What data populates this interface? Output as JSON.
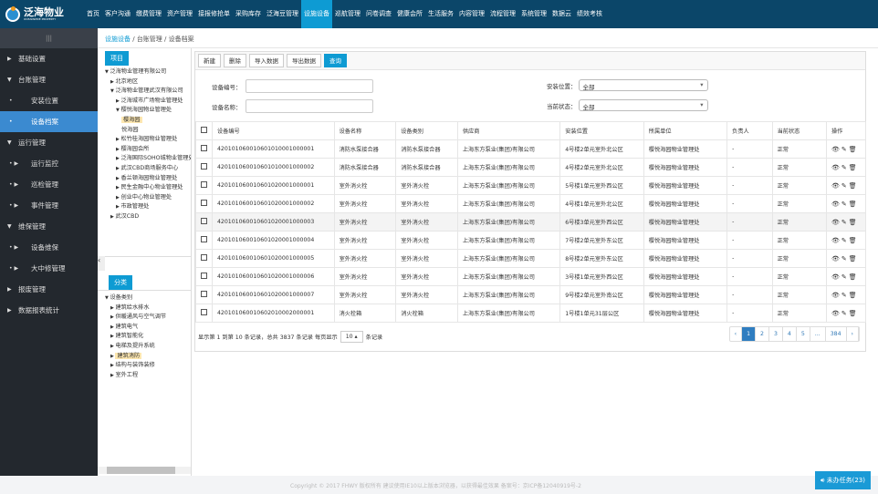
{
  "brand": {
    "name": "泛海物业",
    "sub": "OCEANWIDE PROPERTY"
  },
  "nav": [
    "首页",
    "客户沟通",
    "缴费管理",
    "资产管理",
    "接报修抢单",
    "采购库存",
    "泛海豆管理",
    "设施设备",
    "巡航管理",
    "问卷调查",
    "健康会所",
    "生活服务",
    "内容管理",
    "流程管理",
    "系统管理",
    "数据云",
    "绩效考核"
  ],
  "nav_active": 7,
  "sidebar": {
    "toggle": "|||",
    "items": [
      {
        "label": "基础设置",
        "icon": "caret-right",
        "sub": false
      },
      {
        "label": "台账管理",
        "icon": "caret-down",
        "sub": false
      },
      {
        "label": "安装位置",
        "icon": "dot",
        "sub": true
      },
      {
        "label": "设备档案",
        "icon": "dot",
        "sub": true,
        "active": true
      },
      {
        "label": "运行管理",
        "icon": "caret-down",
        "sub": false
      },
      {
        "label": "运行监控",
        "icon": "dot-caret",
        "sub": true
      },
      {
        "label": "巡检管理",
        "icon": "dot-caret",
        "sub": true
      },
      {
        "label": "事件管理",
        "icon": "dot-caret",
        "sub": true
      },
      {
        "label": "维保管理",
        "icon": "caret-down",
        "sub": false
      },
      {
        "label": "设备维保",
        "icon": "dot-caret",
        "sub": true
      },
      {
        "label": "大中修管理",
        "icon": "dot-caret",
        "sub": true
      },
      {
        "label": "报废管理",
        "icon": "caret-right",
        "sub": false
      },
      {
        "label": "数据报表统计",
        "icon": "caret-right",
        "sub": false
      }
    ]
  },
  "breadcrumb": [
    "设施设备",
    "台账管理",
    "设备档案"
  ],
  "tree1": {
    "tab": "项目",
    "nodes": [
      {
        "t": "泛海物业管理有限公司",
        "d": 0,
        "i": "▼"
      },
      {
        "t": "北京地区",
        "d": 1,
        "i": "▶"
      },
      {
        "t": "泛海物业管理武汉有限公司",
        "d": 1,
        "i": "▼"
      },
      {
        "t": "泛海城市广场物业管理处",
        "d": 2,
        "i": "▶"
      },
      {
        "t": "樱悦海园物业管理处",
        "d": 2,
        "i": "▼"
      },
      {
        "t": "樱海园",
        "d": 3,
        "i": "",
        "hl": true
      },
      {
        "t": "悦海园",
        "d": 3,
        "i": ""
      },
      {
        "t": "松竹桂海园物业管理处",
        "d": 2,
        "i": "▶"
      },
      {
        "t": "樱海园会所",
        "d": 2,
        "i": "▶"
      },
      {
        "t": "泛海国际SOHO城物业管理处",
        "d": 2,
        "i": "▶"
      },
      {
        "t": "武汉CBD商场服务中心",
        "d": 2,
        "i": "▶"
      },
      {
        "t": "香兰顿海园物业管理处",
        "d": 2,
        "i": "▶"
      },
      {
        "t": "民生金融中心物业管理处",
        "d": 2,
        "i": "▶"
      },
      {
        "t": "创业中心物业管理处",
        "d": 2,
        "i": "▶"
      },
      {
        "t": "市政管理处",
        "d": 2,
        "i": "▶"
      },
      {
        "t": "武汉CBD",
        "d": 1,
        "i": "▶"
      }
    ]
  },
  "tree2": {
    "tab": "分类",
    "nodes": [
      {
        "t": "设备类别",
        "d": 0,
        "i": "▼"
      },
      {
        "t": "建筑给水排水",
        "d": 1,
        "i": "▶"
      },
      {
        "t": "供暖通风与空气调节",
        "d": 1,
        "i": "▶"
      },
      {
        "t": "建筑电气",
        "d": 1,
        "i": "▶"
      },
      {
        "t": "建筑智能化",
        "d": 1,
        "i": "▶"
      },
      {
        "t": "电梯及提升系统",
        "d": 1,
        "i": "▶"
      },
      {
        "t": "建筑消防",
        "d": 1,
        "i": "▶",
        "hl": true
      },
      {
        "t": "结构与装饰装修",
        "d": 1,
        "i": "▶"
      },
      {
        "t": "室外工程",
        "d": 1,
        "i": "▶"
      }
    ]
  },
  "toolbar": {
    "new": "新建",
    "delete": "删除",
    "import": "导入数据",
    "export": "导出数据",
    "query": "查询"
  },
  "filters": {
    "code_label": "设备编号：",
    "code_value": "",
    "name_label": "设备名称：",
    "name_value": "",
    "location_label": "安装位置：",
    "location_value": "全部",
    "status_label": "当前状态：",
    "status_value": "全部"
  },
  "table": {
    "headers": [
      "设备编号",
      "设备名称",
      "设备类别",
      "供应商",
      "安装位置",
      "所属单位",
      "负责人",
      "当前状态",
      "操作"
    ],
    "rows": [
      [
        "420101060010601010001000001",
        "消防水泵接合器",
        "消防水泵接合器",
        "上海东方泵业(集团)有限公司",
        "4号楼2单元室外北公区",
        "樱悦海园物业管理处",
        "-",
        "正常"
      ],
      [
        "420101060010601010001000002",
        "消防水泵接合器",
        "消防水泵接合器",
        "上海东方泵业(集团)有限公司",
        "4号楼2单元室外北公区",
        "樱悦海园物业管理处",
        "-",
        "正常"
      ],
      [
        "420101060010601020001000001",
        "室外消火栓",
        "室外消火栓",
        "上海东方泵业(集团)有限公司",
        "5号楼1单元室外西公区",
        "樱悦海园物业管理处",
        "-",
        "正常"
      ],
      [
        "420101060010601020001000002",
        "室外消火栓",
        "室外消火栓",
        "上海东方泵业(集团)有限公司",
        "4号楼1单元室外北公区",
        "樱悦海园物业管理处",
        "-",
        "正常"
      ],
      [
        "420101060010601020001000003",
        "室外消火栓",
        "室外消火栓",
        "上海东方泵业(集团)有限公司",
        "6号楼3单元室外西公区",
        "樱悦海园物业管理处",
        "-",
        "正常"
      ],
      [
        "420101060010601020001000004",
        "室外消火栓",
        "室外消火栓",
        "上海东方泵业(集团)有限公司",
        "7号楼2单元室外东公区",
        "樱悦海园物业管理处",
        "-",
        "正常"
      ],
      [
        "420101060010601020001000005",
        "室外消火栓",
        "室外消火栓",
        "上海东方泵业(集团)有限公司",
        "8号楼2单元室外东公区",
        "樱悦海园物业管理处",
        "-",
        "正常"
      ],
      [
        "420101060010601020001000006",
        "室外消火栓",
        "室外消火栓",
        "上海东方泵业(集团)有限公司",
        "3号楼1单元室外西公区",
        "樱悦海园物业管理处",
        "-",
        "正常"
      ],
      [
        "420101060010601020001000007",
        "室外消火栓",
        "室外消火栓",
        "上海东方泵业(集团)有限公司",
        "9号楼2单元室外南公区",
        "樱悦海园物业管理处",
        "-",
        "正常"
      ],
      [
        "420101060010602010002000001",
        "消火栓箱",
        "消火栓箱",
        "上海东方泵业(集团)有限公司",
        "1号楼1单元31层公区",
        "樱悦海园物业管理处",
        "-",
        "正常"
      ]
    ]
  },
  "pagination": {
    "summary": "显示第 1 到第 10 条记录，总共 3837 条记录 每页显示",
    "page_size": "10 ▴",
    "suffix": "条记录",
    "prev": "‹",
    "pages": [
      "1",
      "2",
      "3",
      "4",
      "5",
      "...",
      "384"
    ],
    "current": "1",
    "next": "›"
  },
  "footer": {
    "copyright": "Copyright © 2017 FHWY 版权所有 建议使用IE10以上版本浏览器，以获得最佳效果 备案号：京ICP备12040919号-2",
    "task": "未办任务(23)"
  }
}
